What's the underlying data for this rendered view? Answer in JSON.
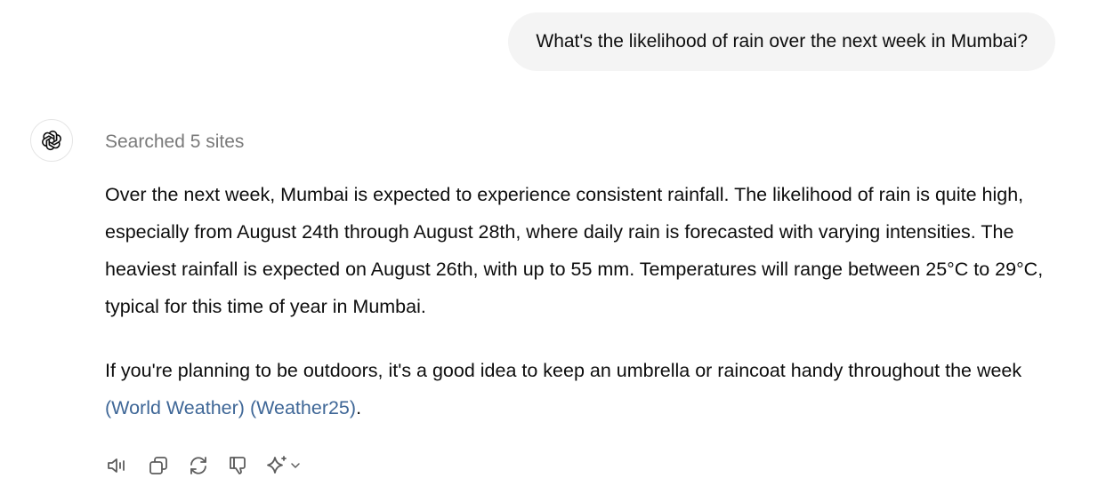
{
  "user_message": "What's the likelihood of rain over the next week in Mumbai?",
  "assistant": {
    "avatar_icon": "openai-logo-icon",
    "search_status": "Searched 5 sites",
    "paragraph1": "Over the next week, Mumbai is expected to experience consistent rainfall. The likelihood of rain is quite high, especially from August 24th through August 28th, where daily rain is forecasted with varying intensities. The heaviest rainfall is expected on August 26th, with up to 55 mm. Temperatures will range between 25°C to 29°C, typical for this time of year in Mumbai.",
    "paragraph2_text": "If you're planning to be outdoors, it's a good idea to keep an umbrella or raincoat handy throughout the week ",
    "citations": [
      {
        "label": "World Weather"
      },
      {
        "label": "Weather25"
      }
    ],
    "paragraph2_end": "."
  },
  "actions": [
    {
      "icon": "read-aloud-icon"
    },
    {
      "icon": "copy-icon"
    },
    {
      "icon": "regenerate-icon"
    },
    {
      "icon": "thumbs-down-icon"
    },
    {
      "icon": "sparkle-model-icon"
    }
  ],
  "colors": {
    "user_bubble": "#f4f4f4",
    "citation": "#3f6797",
    "muted_text": "#7a7a7a",
    "icon": "#5d5d5d"
  }
}
